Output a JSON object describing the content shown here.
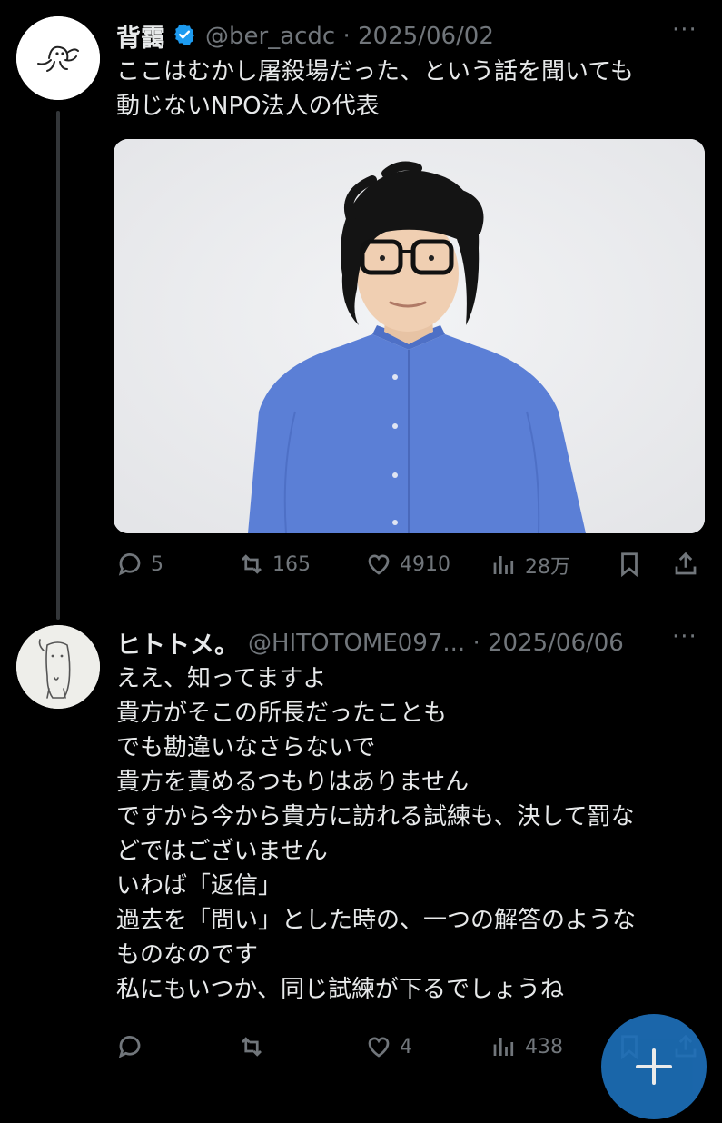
{
  "tweet1": {
    "author_name": "背靄",
    "handle_date": "@ber_acdc · 2025/06/02",
    "text": "ここはむかし屠殺場だった、という話を聞いても\n動じないNPO法人の代表",
    "more": "···",
    "actions": {
      "replies": "5",
      "retweets": "165",
      "likes": "4910",
      "views": "28万"
    }
  },
  "tweet2": {
    "author_name": "ヒトトメ。",
    "handle_date": "@HITOTOME097... · 2025/06/06",
    "text": "ええ、知ってますよ\n貴方がそこの所長だったことも\nでも勘違いなさらないで\n貴方を責めるつもりはありません\nですから今から貴方に訪れる試練も、決して罰な\nどではございません\nいわば「返信」\n過去を「問い」とした時の、一つの解答のような\nものなのです\n私にもいつか、同じ試練が下るでしょうね",
    "more": "···",
    "actions": {
      "replies": "",
      "retweets": "",
      "likes": "4",
      "views": "438"
    }
  },
  "colors": {
    "background": "#000000",
    "text": "#e7e9ea",
    "muted": "#71767b",
    "verified": "#1d9bf0",
    "fab": "#1d6fb8"
  }
}
